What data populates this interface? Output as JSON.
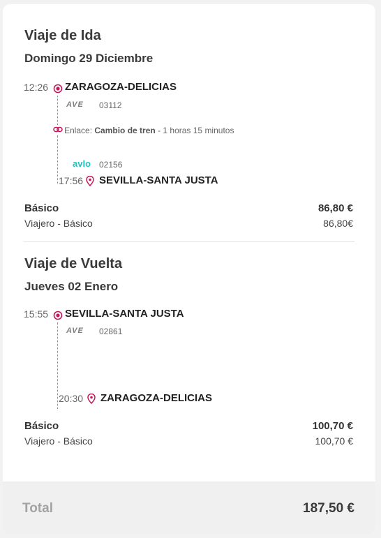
{
  "outbound": {
    "title": "Viaje de Ida",
    "date": "Domingo 29 Diciembre",
    "departure": {
      "time": "12:26",
      "station": "ZARAGOZA-DELICIAS"
    },
    "leg1": {
      "operator": "AVE",
      "train_number": "03112"
    },
    "connection": {
      "prefix": "Enlace:",
      "type": "Cambio de tren",
      "duration": " - 1 horas 15 minutos"
    },
    "leg2": {
      "operator": "avlo",
      "train_number": "02156"
    },
    "arrival": {
      "time": "17:56",
      "station": "SEVILLA-SANTA JUSTA"
    },
    "fare": {
      "name": "Básico",
      "price": "86,80 €",
      "passenger": "Viajero - Básico",
      "passenger_price": "86,80€"
    }
  },
  "return": {
    "title": "Viaje de Vuelta",
    "date": "Jueves 02 Enero",
    "departure": {
      "time": "15:55",
      "station": "SEVILLA-SANTA JUSTA"
    },
    "leg1": {
      "operator": "AVE",
      "train_number": "02861"
    },
    "arrival": {
      "time": "20:30",
      "station": "ZARAGOZA-DELICIAS"
    },
    "fare": {
      "name": "Básico",
      "price": "100,70 €",
      "passenger": "Viajero - Básico",
      "passenger_price": "100,70 €"
    }
  },
  "summary": {
    "total_label": "Total",
    "total_value": "187,50 €"
  },
  "colors": {
    "accent": "#c2185b",
    "avlo": "#21c3c0",
    "ave": "#7d7d7d"
  }
}
